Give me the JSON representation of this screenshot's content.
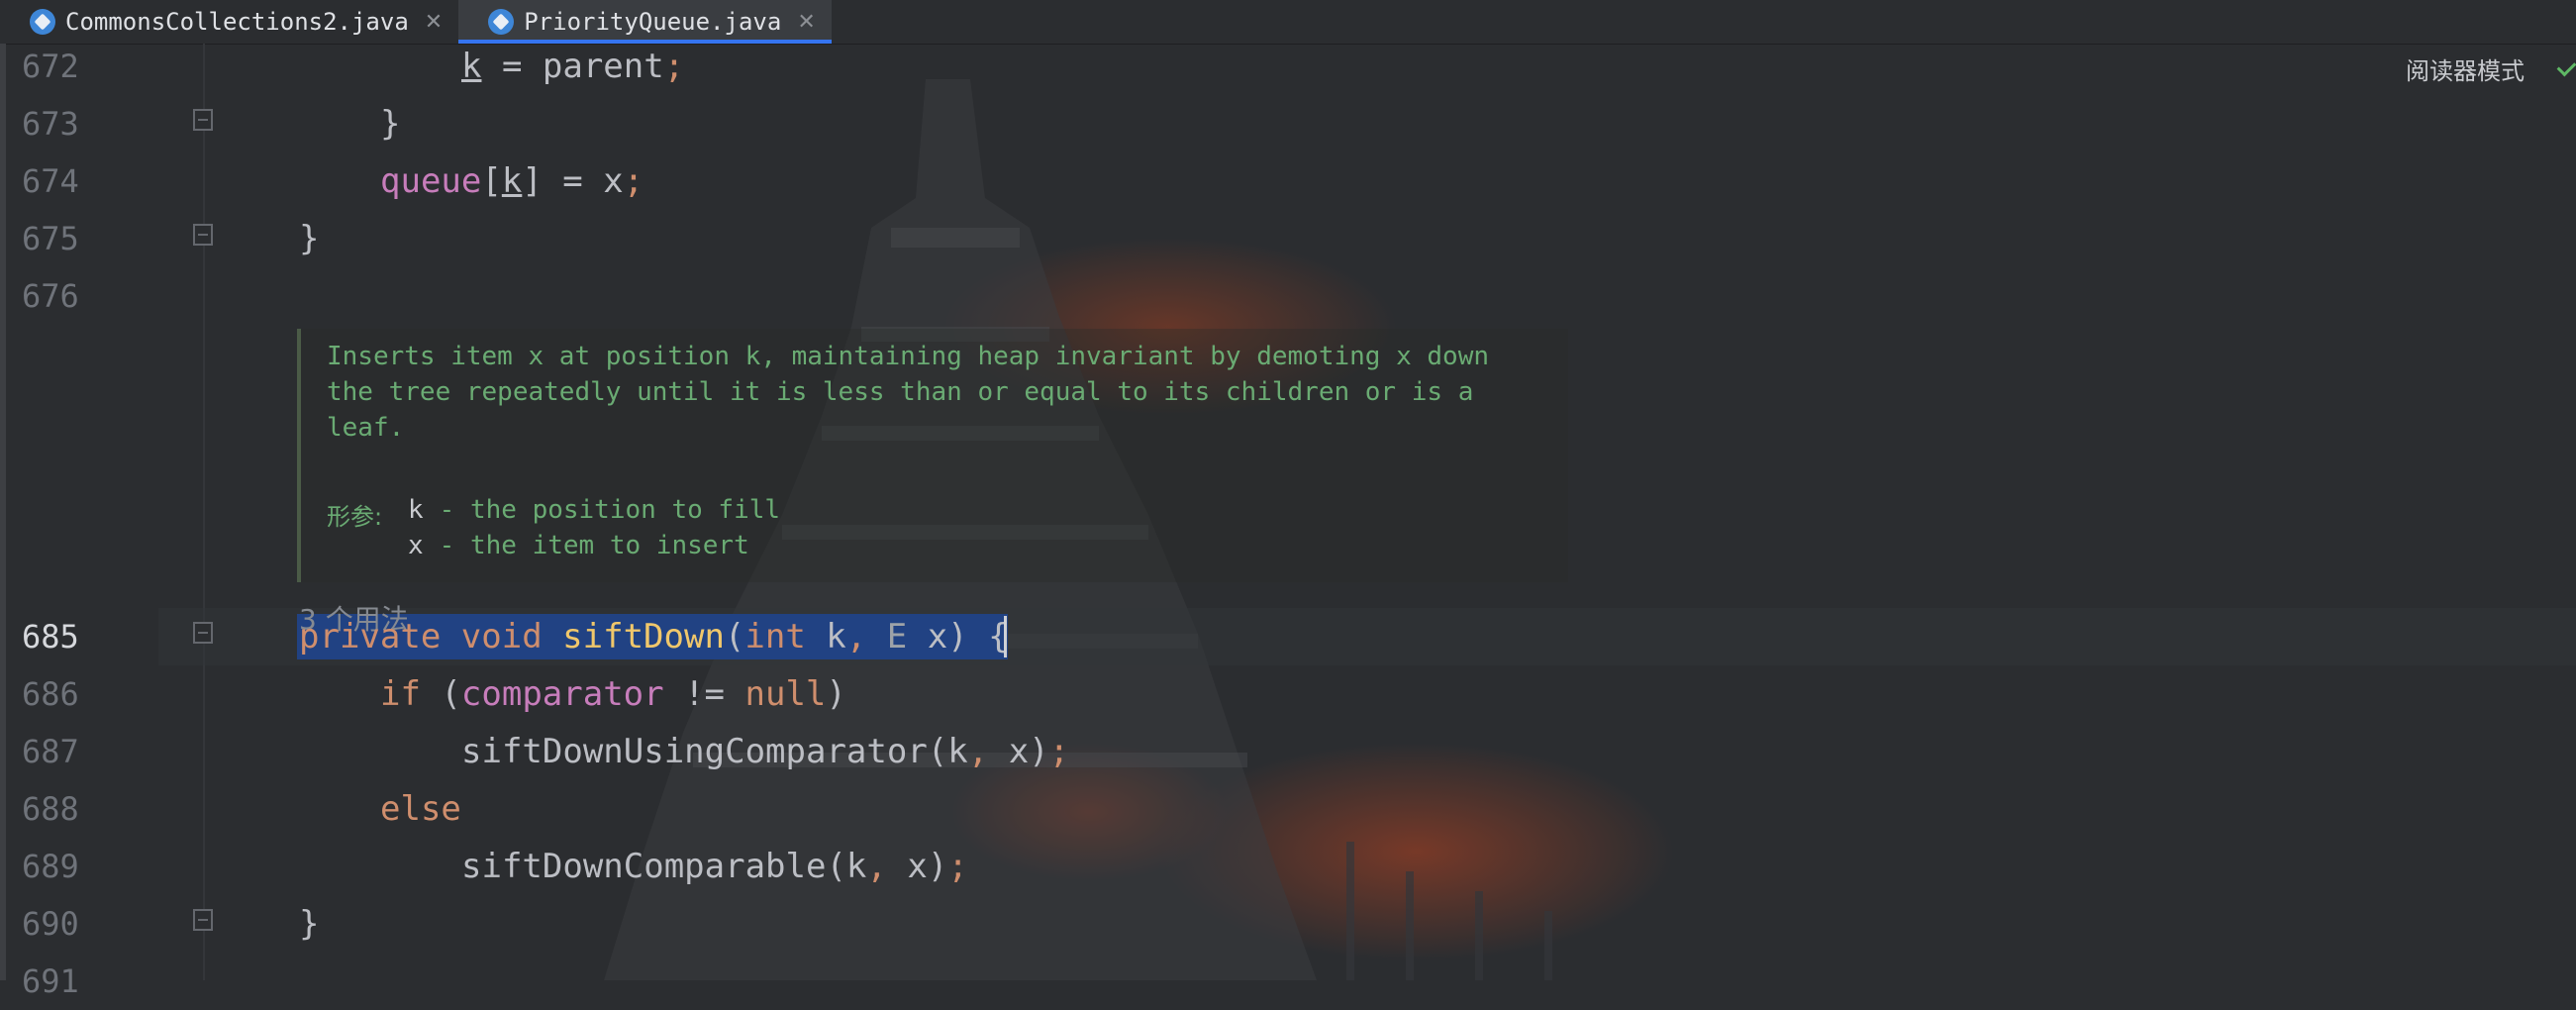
{
  "tabs": [
    {
      "label": "CommonsCollections2.java",
      "active": false,
      "icon": "java-class-icon"
    },
    {
      "label": "PriorityQueue.java",
      "active": true,
      "icon": "java-class-icon"
    }
  ],
  "reader_mode": {
    "label": "阅读器模式"
  },
  "lines": {
    "l672": "672",
    "l673": "673",
    "l674": "674",
    "l675": "675",
    "l676": "676",
    "l685": "685",
    "l686": "686",
    "l687": "687",
    "l688": "688",
    "l689": "689",
    "l690": "690",
    "l691": "691"
  },
  "code": {
    "k672_k": "k",
    "k672_eq": " = parent",
    "k672_semi": ";",
    "k673": "}",
    "k674_queue": "queue",
    "k674_open": "[",
    "k674_k": "k",
    "k674_rest": "] = x",
    "k674_semi": ";",
    "k675": "}",
    "k685_private": "private",
    "k685_void": "void",
    "k685_name": "siftDown",
    "k685_open": "(",
    "k685_int": "int",
    "k685_k": " k",
    "k685_comma": ",",
    "k685_E": " E",
    "k685_x": " x) {",
    "k686_if": "if",
    "k686_open": " (",
    "k686_comp": "comparator",
    "k686_neq": " != ",
    "k686_null": "null",
    "k686_close": ")",
    "k687_call": "siftDownUsingComparator(k",
    "k687_comma": ",",
    "k687_x": " x)",
    "k687_semi": ";",
    "k688_else": "else",
    "k689_call": "siftDownComparable(k",
    "k689_comma": ",",
    "k689_x": " x)",
    "k689_semi": ";",
    "k690": "}"
  },
  "doc": {
    "line1": "Inserts item x at position k, maintaining heap invariant by demoting x down",
    "line2": "the tree repeatedly until it is less than or equal to its children or is a",
    "line3": "leaf.",
    "params_label": "形参:",
    "param1_name": "k",
    "param1_desc": " - the position to fill",
    "param2_name": "x",
    "param2_desc": " - the item to insert"
  },
  "usages": "3 个用法",
  "colors": {
    "keyword": "#cf8e6d",
    "method": "#56a8f5",
    "field": "#c77dbb",
    "doc_comment": "#6aab73",
    "selection": "#214283",
    "active_tab_indicator": "#3574f0"
  }
}
